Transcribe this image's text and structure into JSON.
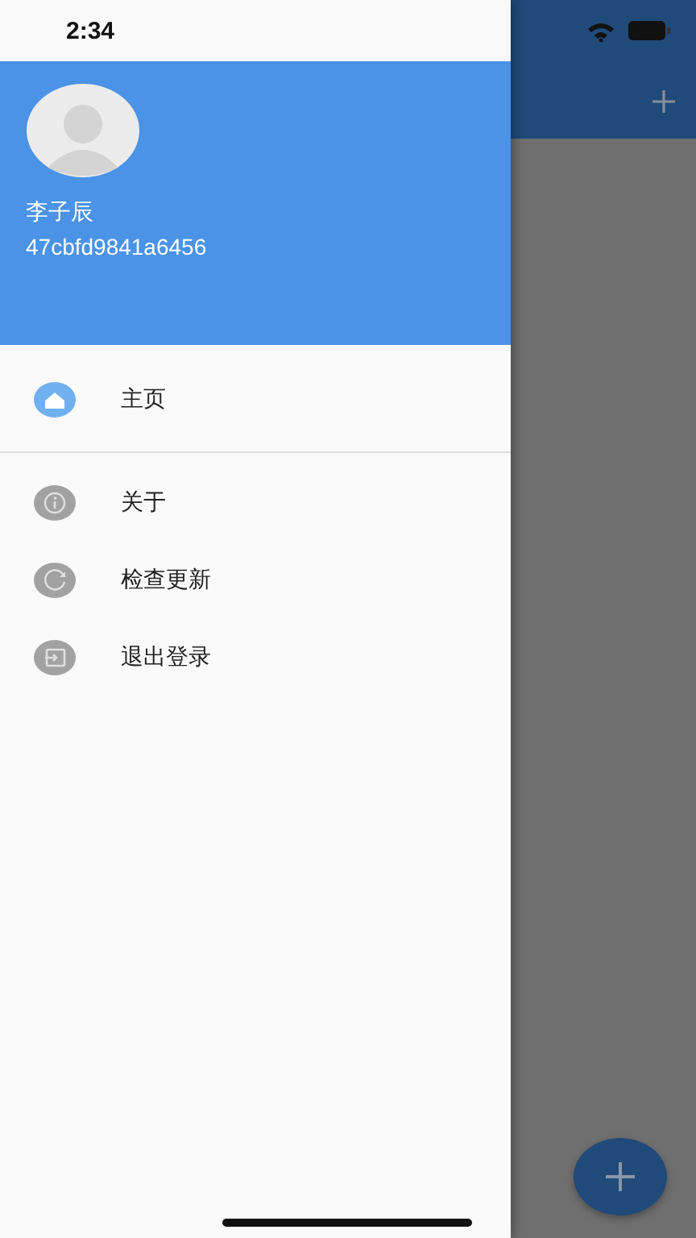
{
  "status_bar": {
    "time": "2:34"
  },
  "drawer": {
    "header": {
      "name": "李子辰",
      "user_id": "47cbfd9841a6456"
    },
    "items": [
      {
        "label": "主页",
        "kind": "home",
        "selected": true
      },
      {
        "label": "关于",
        "kind": "info",
        "selected": false
      },
      {
        "label": "检查更新",
        "kind": "refresh",
        "selected": false
      },
      {
        "label": "退出登录",
        "kind": "logout",
        "selected": false
      }
    ]
  }
}
